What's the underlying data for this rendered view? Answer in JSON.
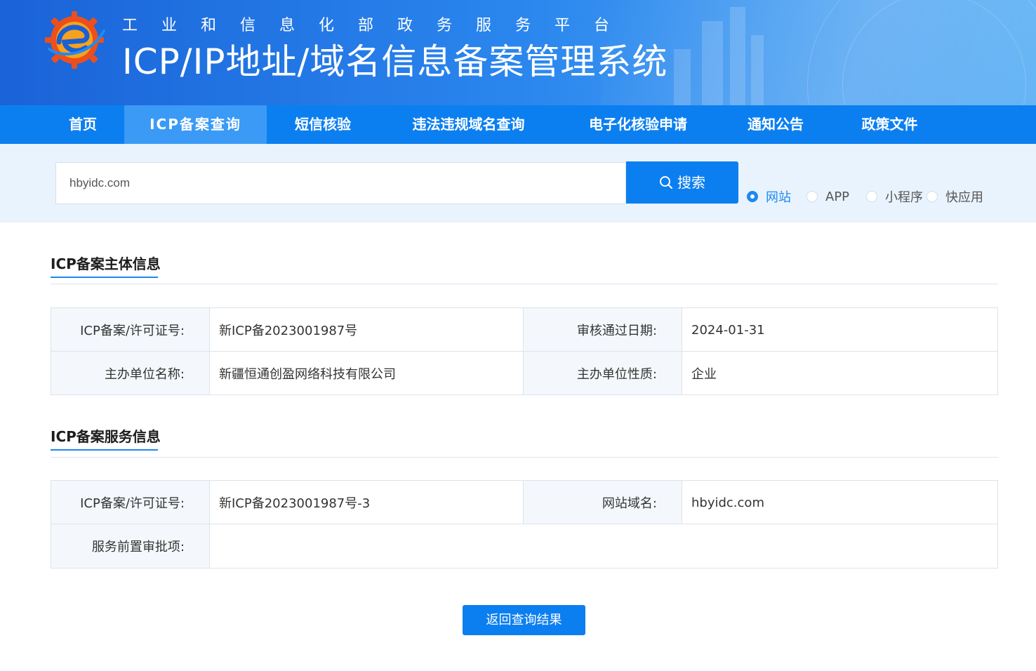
{
  "header": {
    "subtitle": "工业和信息化部政务服务平台",
    "title": "ICP/IP地址/域名信息备案管理系统"
  },
  "nav": {
    "items": [
      {
        "label": "首页"
      },
      {
        "label": "ICP备案查询"
      },
      {
        "label": "短信核验"
      },
      {
        "label": "违法违规域名查询"
      },
      {
        "label": "电子化核验申请"
      },
      {
        "label": "通知公告"
      },
      {
        "label": "政策文件"
      }
    ],
    "active": "ICP备案查询"
  },
  "search": {
    "value": "hbyidc.com",
    "button_label": "搜索",
    "types": [
      {
        "label": "网站",
        "checked": true
      },
      {
        "label": "APP",
        "checked": false
      },
      {
        "label": "小程序",
        "checked": false
      },
      {
        "label": "快应用",
        "checked": false
      }
    ]
  },
  "subject_info": {
    "title": "ICP备案主体信息",
    "license_label": "ICP备案/许可证号:",
    "license_value": "新ICP备2023001987号",
    "approve_date_label": "审核通过日期:",
    "approve_date_value": "2024-01-31",
    "org_name_label": "主办单位名称:",
    "org_name_value": "新疆恒通创盈网络科技有限公司",
    "org_type_label": "主办单位性质:",
    "org_type_value": "企业"
  },
  "service_info": {
    "title": "ICP备案服务信息",
    "license_label": "ICP备案/许可证号:",
    "license_value": "新ICP备2023001987号-3",
    "domain_label": "网站域名:",
    "domain_value": "hbyidc.com",
    "pre_approval_label": "服务前置审批项:",
    "pre_approval_value": ""
  },
  "back_button_label": "返回查询结果",
  "colors": {
    "primary": "#0c7ff0",
    "nav_active": "#3a9af5",
    "label_bg": "#f4f8fc"
  }
}
